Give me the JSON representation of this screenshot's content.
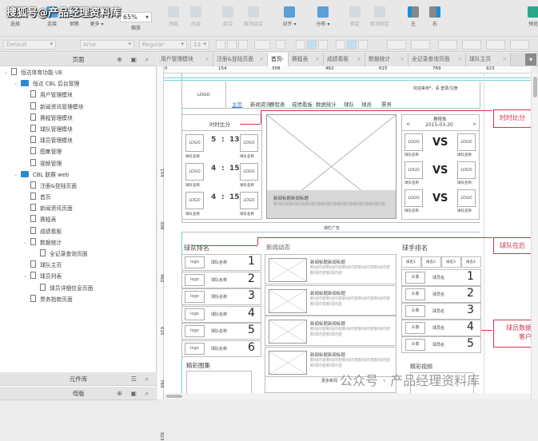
{
  "watermark_top": "搜狐号@产品经理资料库",
  "watermark_bottom": "公众号 · 产品经理资料库",
  "toolbar": {
    "select": "选择",
    "connect": "连接",
    "pen": "钢笔",
    "more": "更多 ▾",
    "zoom_value": "65%",
    "zoom_label": "缩放",
    "top": "顶层",
    "bottom": "底层",
    "group": "组合",
    "ungroup": "取消组合",
    "align": "对齐 ▾",
    "distribute": "分布 ▾",
    "lock": "锁定",
    "unlock": "取消锁定",
    "left": "左",
    "right": "右",
    "preview": "预览"
  },
  "format": {
    "style": "Default",
    "font": "Arial",
    "weight": "Regular",
    "size": "13"
  },
  "pages_panel": {
    "title": "页面",
    "items": [
      {
        "label": "恒达体育功能 UE",
        "type": "page",
        "level": 0,
        "expanded": true
      },
      {
        "label": "恒达 CBL 后台管理",
        "type": "folder",
        "level": 1,
        "expanded": true
      },
      {
        "label": "用户管理模块",
        "type": "page",
        "level": 2
      },
      {
        "label": "新闻资讯管理模块",
        "type": "page",
        "level": 2
      },
      {
        "label": "赛程管理模块",
        "type": "page",
        "level": 2
      },
      {
        "label": "球队管理模块",
        "type": "page",
        "level": 2
      },
      {
        "label": "球员管理模块",
        "type": "page",
        "level": 2
      },
      {
        "label": "图集管理",
        "type": "page",
        "level": 2
      },
      {
        "label": "视频管理",
        "type": "page",
        "level": 2
      },
      {
        "label": "CBL 联赛 web",
        "type": "folder",
        "level": 1,
        "expanded": true
      },
      {
        "label": "注册&登陆页面",
        "type": "page",
        "level": 2
      },
      {
        "label": "首页",
        "type": "page",
        "level": 2
      },
      {
        "label": "新闻资讯页面",
        "type": "page",
        "level": 2
      },
      {
        "label": "赛程表",
        "type": "page",
        "level": 2
      },
      {
        "label": "成绩看板",
        "type": "page",
        "level": 2
      },
      {
        "label": "数据统计",
        "type": "page",
        "level": 2,
        "expanded": true
      },
      {
        "label": "全记录查询页面",
        "type": "page",
        "level": 3
      },
      {
        "label": "球队主页",
        "type": "page",
        "level": 2
      },
      {
        "label": "球员列表",
        "type": "page",
        "level": 2,
        "expanded": true
      },
      {
        "label": "球员详细信息页面",
        "type": "page",
        "level": 3
      },
      {
        "label": "票务指南页面",
        "type": "page",
        "level": 2
      }
    ]
  },
  "widgets_panel": {
    "title": "元件库"
  },
  "masters_panel": {
    "title": "母版"
  },
  "tabs": [
    {
      "label": "用户管理模块",
      "active": false
    },
    {
      "label": "注册&登陆页面",
      "active": false
    },
    {
      "label": "首页",
      "active": true
    },
    {
      "label": "赛程表",
      "active": false
    },
    {
      "label": "成绩看板",
      "active": false
    },
    {
      "label": "数据统计",
      "active": false
    },
    {
      "label": "全记录查询页面",
      "active": false
    },
    {
      "label": "球队主页",
      "active": false
    }
  ],
  "ruler_marks": [
    "0",
    "154",
    "308",
    "462",
    "615",
    "769",
    "923"
  ],
  "wireframe": {
    "logo": "LOGO",
    "welcome": "欢迎来到*，请 登录/注册",
    "nav": [
      "主页",
      "新闻资讯",
      "赛程表",
      "成绩看板",
      "数据统计",
      "球队",
      "球员",
      "票务"
    ],
    "live_title": "时时比分",
    "live_scores": [
      {
        "home": "5",
        "away": "13"
      },
      {
        "home": "4",
        "away": "15"
      },
      {
        "home": "4",
        "away": "15"
      }
    ],
    "team_name": "球队名称",
    "score_sep": ":",
    "news_caption_title": "新闻标题新闻标题",
    "news_caption_body": "新闻内容新闻内容新闻内容新闻内容新闻内容新闻内容新闻内容...",
    "schedule_title": "赛程表",
    "schedule_date": "2015-03-20",
    "prev": "<",
    "next": ">",
    "vs": "VS",
    "ad": "通栏广告",
    "team_rank_title": "球队排名",
    "team_rank_logo": "logo",
    "team_ranks": [
      "1",
      "2",
      "3",
      "4",
      "5",
      "6"
    ],
    "news_title": "新闻动态",
    "news_item_title": "新闻标题新闻标题",
    "news_item_body": "新闻内容新闻内容新闻内容新闻内容新闻内容新闻内容新闻内容",
    "more_news": "更多新闻",
    "player_rank_title": "球手排名",
    "player_tabs": [
      "排名1",
      "排名2",
      "排名3",
      "排名4"
    ],
    "avatar": "头像",
    "player_name": "球员名",
    "player_ranks": [
      "1",
      "2",
      "3",
      "4",
      "5"
    ],
    "gallery_title": "精彩图集",
    "video_title": "精彩视频"
  },
  "annotations": [
    "时时比分",
    "球队在后",
    "球员数据",
    "客户"
  ],
  "colors": {
    "annotation": "#d6334b",
    "guide": "#7ad3d8",
    "folder": "#2b8ad0",
    "nav_active": "#3a7bd5"
  }
}
